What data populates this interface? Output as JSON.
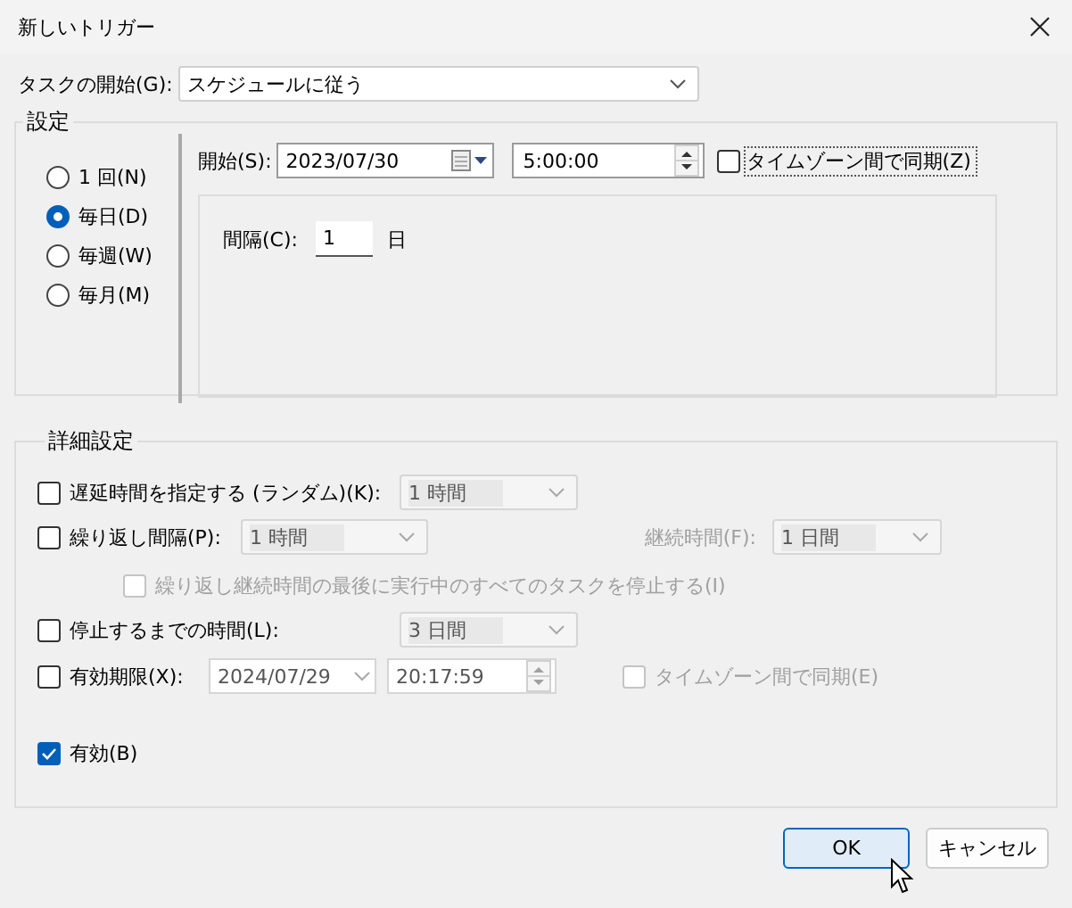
{
  "window": {
    "title": "新しいトリガー"
  },
  "start_task": {
    "label": "タスクの開始(G):",
    "value": "スケジュールに従う"
  },
  "settings": {
    "title": "設定",
    "schedule_options": [
      {
        "label": "1 回(N)",
        "selected": false
      },
      {
        "label": "毎日(D)",
        "selected": true
      },
      {
        "label": "毎週(W)",
        "selected": false
      },
      {
        "label": "毎月(M)",
        "selected": false
      }
    ],
    "start": {
      "label": "開始(S):",
      "date": "2023/07/30",
      "time": "5:00:00"
    },
    "sync_timezone": {
      "label": "タイムゾーン間で同期(Z)",
      "checked": false
    },
    "interval": {
      "label": "間隔(C):",
      "value": "1",
      "unit": "日"
    }
  },
  "advanced": {
    "title": "詳細設定",
    "delay": {
      "label": "遅延時間を指定する (ランダム)(K):",
      "checked": false,
      "combo": {
        "value": "1 時間",
        "disabled": true
      }
    },
    "repeat": {
      "label": "繰り返し間隔(P):",
      "checked": false,
      "combo": {
        "value": "1 時間",
        "disabled": true
      },
      "duration": {
        "label": "継続時間(F):",
        "disabled": true,
        "combo": {
          "value": "1 日間",
          "disabled": true
        }
      }
    },
    "stop_all": {
      "label": "繰り返し継続時間の最後に実行中のすべてのタスクを停止する(I)",
      "checked": false,
      "disabled": true
    },
    "stop_after": {
      "label": "停止するまでの時間(L):",
      "checked": false,
      "combo": {
        "value": "3 日間",
        "disabled": true
      }
    },
    "expire": {
      "label": "有効期限(X):",
      "checked": false,
      "date": {
        "value": "2024/07/29",
        "disabled": true
      },
      "time": {
        "value": "20:17:59",
        "disabled": true
      }
    },
    "expire_sync": {
      "label": "タイムゾーン間で同期(E)",
      "checked": false,
      "disabled": true
    },
    "enabled": {
      "label": "有効(B)",
      "checked": true
    }
  },
  "buttons": [
    {
      "label": "OK",
      "kind": "default"
    },
    {
      "label": "キャンセル",
      "kind": "normal"
    }
  ]
}
